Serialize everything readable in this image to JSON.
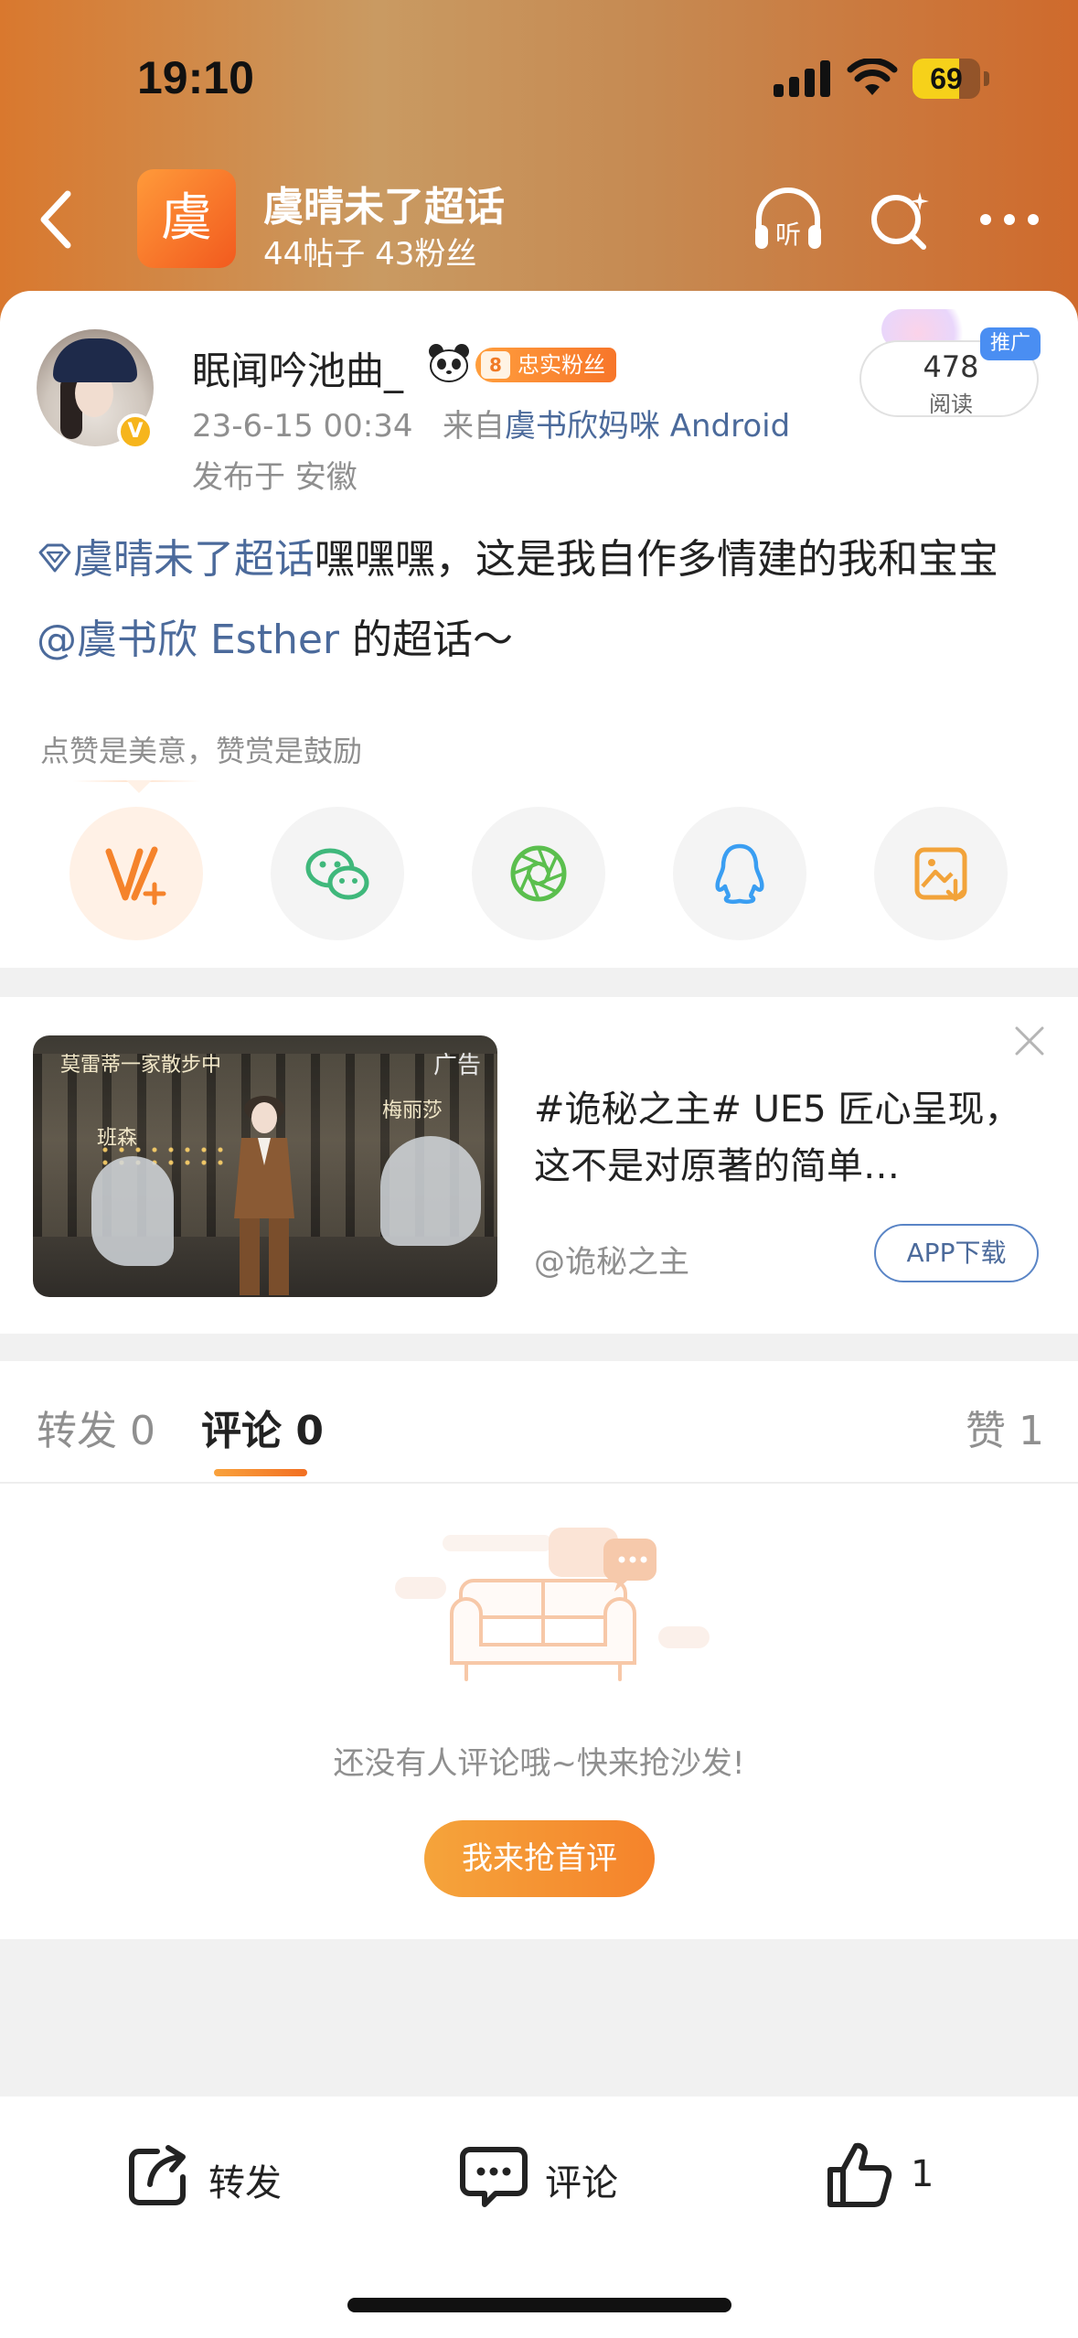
{
  "status_bar": {
    "time": "19:10",
    "battery": "69",
    "battery_level": 0.69
  },
  "nav": {
    "topic_logo_char": "虞",
    "title": "虞晴未了超话",
    "subtitle": "44帖子 43粉丝"
  },
  "post": {
    "username": "眠闻吟池曲_",
    "fan_level": "8",
    "fan_badge": "忠实粉丝",
    "time": "23-6-15 00:34",
    "source_prefix": "来自",
    "source": "虞书欣妈咪 Android",
    "location": "发布于 安徽",
    "read_count": "478",
    "read_label": "阅读",
    "promo_label": "推广",
    "topic_link": "虞晴未了超话",
    "text_part1": "嘿嘿嘿，这是我自作多情建的我和宝宝 ",
    "mention": "@虞书欣 Esther",
    "text_part2": " 的超话～",
    "reward_hint": "点赞是美意，赞赏是鼓励"
  },
  "share_icons": [
    "reward-icon",
    "wechat-icon",
    "moments-icon",
    "qq-icon",
    "save-image-icon"
  ],
  "ad": {
    "image_captions": {
      "top": "莫雷蒂一家散步中",
      "left": "班森",
      "right": "梅丽莎"
    },
    "ad_tag": "广告",
    "title": "#诡秘之主# UE5 匠心呈现，这不是对原著的简单…",
    "source": "@诡秘之主",
    "button": "APP下载"
  },
  "comments": {
    "tabs": {
      "repost": {
        "label": "转发",
        "count": "0"
      },
      "comment": {
        "label": "评论",
        "count": "0"
      },
      "like": {
        "label": "赞",
        "count": "1"
      }
    },
    "empty_text": "还没有人评论哦~快来抢沙发!",
    "first_button": "我来抢首评"
  },
  "bottom_bar": {
    "repost": "转发",
    "comment": "评论",
    "like_count": "1"
  },
  "colors": {
    "accent_orange": "#f5832b",
    "link_blue": "#4b6a9b",
    "secondary_text": "#8f8f8f"
  }
}
